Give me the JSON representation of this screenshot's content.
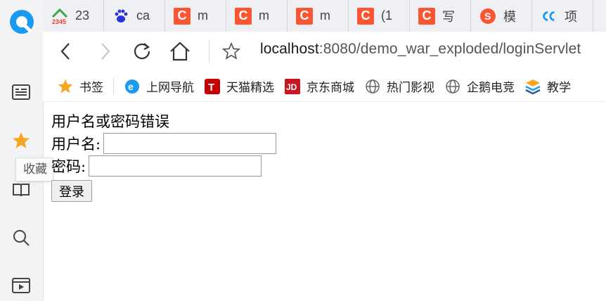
{
  "tooltip": "收藏",
  "tabs": [
    {
      "title": "23",
      "icon": "2345-icon"
    },
    {
      "title": "ca",
      "icon": "baidu-paw-icon"
    },
    {
      "title": "m",
      "icon": "csdn-c-icon"
    },
    {
      "title": "m",
      "icon": "csdn-c-icon"
    },
    {
      "title": "m",
      "icon": "csdn-c-icon"
    },
    {
      "title": "(1",
      "icon": "csdn-c-icon"
    },
    {
      "title": "写",
      "icon": "csdn-c-icon"
    },
    {
      "title": "模",
      "icon": "sogou-s-icon"
    },
    {
      "title": "项",
      "icon": "cc-icon"
    }
  ],
  "address": {
    "host": "localhost",
    "path": ":8080/demo_war_exploded/loginServlet"
  },
  "bookmarks": [
    {
      "label": "书签",
      "icon": "star-icon"
    },
    {
      "label": "上网导航",
      "icon": "ie-e-icon"
    },
    {
      "label": "天猫精选",
      "icon": "tmall-icon"
    },
    {
      "label": "京东商城",
      "icon": "jd-icon"
    },
    {
      "label": "热门影视",
      "icon": "globe-icon"
    },
    {
      "label": "企鹅电竞",
      "icon": "globe-icon"
    },
    {
      "label": "教学",
      "icon": "layers-icon"
    }
  ],
  "page": {
    "error": "用户名或密码错误",
    "username_label": "用户名:",
    "password_label": "密码:",
    "username_value": "",
    "password_value": "",
    "submit": "登录"
  },
  "colors": {
    "accent_orange": "#fc5531",
    "star": "#f5a623",
    "brand_blue": "#1a9af0"
  }
}
